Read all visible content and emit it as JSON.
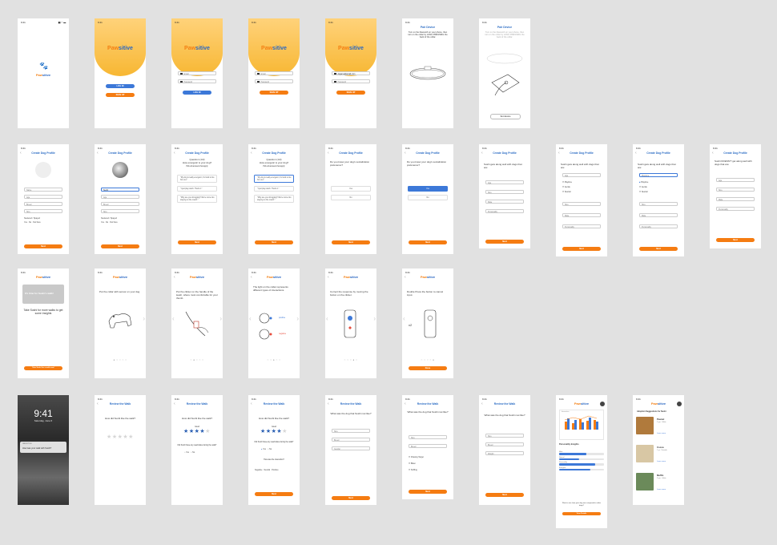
{
  "app": {
    "brand_part1": "Paw",
    "brand_part2": "sitive"
  },
  "status": {
    "time": "9:41",
    "icons": "▮▮ ◠ ▬"
  },
  "auth": {
    "login_label": "LOG IN",
    "signup_label": "SIGN UP",
    "email_placeholder": "Email",
    "password_placeholder": "Password",
    "email_value": "dogsrus@gmail.com"
  },
  "pair": {
    "title": "Pair Device",
    "instruction": "Turn on the bluetooth on your phone, then turn on the collar by LONG PRESSING the back of the collar.",
    "button": "Set device"
  },
  "profile": {
    "title": "Create Dog Profile",
    "name_ph": "Name",
    "name_value": "Sushi",
    "age_ph": "Age",
    "breed_ph": "Breed",
    "size_ph": "Size",
    "neutered_label": "Neutered / Spayed",
    "yes": "Yes",
    "no": "No",
    "not_sure": "Not Sure",
    "next": "Next"
  },
  "questions": {
    "q1_title": "Question (1/2)",
    "q1_text": "How energetic is your dog?",
    "q1_sub": "Pick all answers that apply",
    "q1_opts": [
      "\"My dog is really energetic, it's hard to tire him out.\"",
      "\"I just play catch. That's it.\"",
      "\"Why are you shrugging? We're more into staying on the couch.\""
    ],
    "q2_text": "Do you know your dog's socialization preference?",
    "gets_along": "Sushi gets along well with dogs that are:",
    "doesnt_get_along": "Sushi DOESN'T get along well with dogs that are:",
    "fields": [
      "Age",
      "Size",
      "Male",
      "Personality"
    ],
    "checks": [
      "Playtime",
      "Gentle",
      "Neutral"
    ]
  },
  "tutorial": {
    "promo": "It's time for Sushi's walk!",
    "promo_sub": "Take Sushi for more walks to get some insights",
    "cta": "Take Sushi for a walk now!",
    "steps": [
      "Put the collar with sensor on your dog.",
      "Put the clicker on the handle of the leash, where most comfortable for your thumb.",
      "The light on the collar represents different types of interactions.",
      "Correct the response by moving the button on the clicker.",
      "Double Press the button to cancel input."
    ],
    "positive": "positive",
    "negative": "negative",
    "x2": "x2",
    "done": "Done"
  },
  "lock": {
    "time": "9:41",
    "date": "Saturday, June 6",
    "notif_app": "PAWSITIVE",
    "notif_text": "How was your walk with Sushi?"
  },
  "review": {
    "title": "Review the Walk",
    "q_like": "How did Sushi like the walk?",
    "good": "Good",
    "any_reactivity": "Did Sushi have any reactivities during the walk?",
    "how_reaction": "How was the interaction?",
    "reactions": [
      "Negative",
      "Neutral",
      "Positive"
    ],
    "q_dog": "What was the dog that Sushi met like?",
    "dog_fields": [
      "Size",
      "Breed",
      "Gender"
    ],
    "dog_checks": [
      "Chasing Target",
      "Bitten",
      "Sniffing"
    ],
    "weight": "Weight",
    "next": "Next"
  },
  "insights": {
    "chart_caption": "Interaction",
    "personality_title": "Personality Insights",
    "bars": [
      "Male",
      "Neutral",
      "Personality",
      "Energetic"
    ],
    "question": "Want to see how your dog was compared to other dogs?",
    "btn": "View Details"
  },
  "adopt": {
    "title": "Adoption Suggestions for Sushi",
    "dogs": [
      {
        "name": "Peanut",
        "meta": "2 yrs · Male"
      },
      {
        "name": "Cocoa",
        "meta": "1 yr · Female"
      },
      {
        "name": "Muffin",
        "meta": "3 yrs · Male"
      }
    ],
    "more": "Learn more"
  }
}
